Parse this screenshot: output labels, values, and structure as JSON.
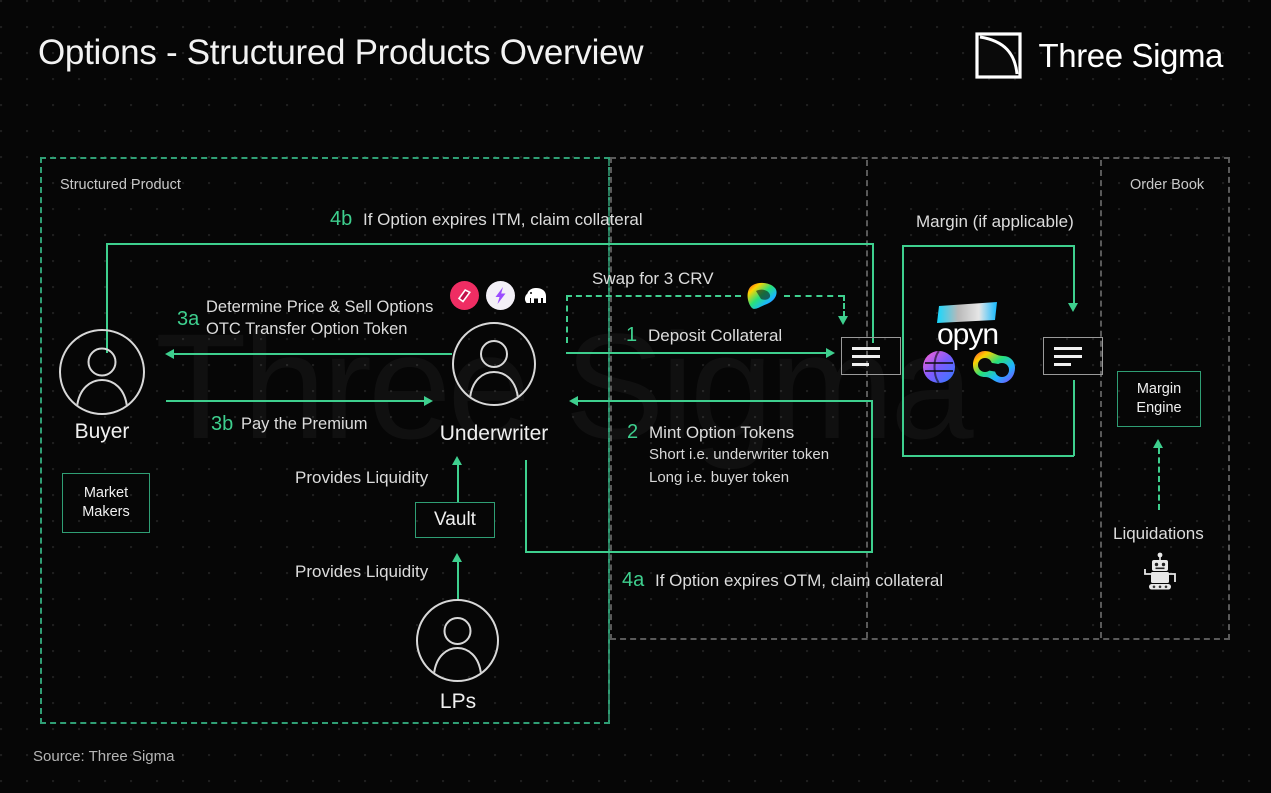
{
  "header": {
    "title": "Options - Structured Products Overview",
    "brand": "Three Sigma",
    "logo_icon": "three-sigma-square-curve-icon"
  },
  "watermark": {
    "text": "Three Sigma"
  },
  "footer": {
    "source": "Source: Three Sigma"
  },
  "regions": [
    {
      "id": "structured-product",
      "label": "Structured Product",
      "border_color": "#2f9e74",
      "style": "dashed"
    },
    {
      "id": "order-book",
      "label": "Order Book",
      "border_color": "#5a5a5a",
      "style": "dashed"
    }
  ],
  "nodes": {
    "buyer": {
      "label": "Buyer",
      "icon": "user-avatar-icon"
    },
    "underwriter": {
      "label": "Underwriter",
      "icon": "user-avatar-icon"
    },
    "lps": {
      "label": "LPs",
      "icon": "user-avatar-icon"
    },
    "market_makers": {
      "label": "Market\nMakers",
      "line1": "Market",
      "line2": "Makers"
    },
    "vault": {
      "label": "Vault"
    },
    "margin_engine": {
      "line1": "Margin",
      "line2": "Engine"
    },
    "liquidations": {
      "label": "Liquidations",
      "icon": "robot-icon"
    },
    "opyn": {
      "label": "opyn",
      "icon": "opyn-logo-icon"
    }
  },
  "labels": {
    "margin_if_applicable": "Margin (if applicable)",
    "swap_for_3crv": "Swap for  3 CRV",
    "provides_liquidity_upper": "Provides Liquidity",
    "provides_liquidity_lower": "Provides Liquidity"
  },
  "steps": [
    {
      "num": "1",
      "text": "Deposit Collateral"
    },
    {
      "num": "2",
      "text": "Mint Option Tokens",
      "sub1": "Short i.e. underwriter token",
      "sub2": "Long i.e. buyer token"
    },
    {
      "num": "3a",
      "text": "Determine Price & Sell Options",
      "sub1": "OTC Transfer Option Token"
    },
    {
      "num": "3b",
      "text": "Pay the Premium"
    },
    {
      "num": "4a",
      "text": "If Option expires OTM, claim collateral"
    },
    {
      "num": "4b",
      "text": "If Option expires ITM, claim collateral"
    }
  ],
  "protocol_icons": [
    {
      "name": "ribbon-finance-icon",
      "color": "#ef2d63"
    },
    {
      "name": "thetanuts-lightning-icon",
      "color": "#ffffff"
    },
    {
      "name": "mammoth-icon",
      "color": "#ffffff"
    },
    {
      "name": "curve-finance-icon",
      "color": "rainbow"
    },
    {
      "name": "aevo-sphere-icon",
      "color": "#5b6ef5"
    },
    {
      "name": "rainbow-ring-icon",
      "color": "rainbow"
    }
  ],
  "order_book_icons": [
    {
      "name": "order-book-icon-left"
    },
    {
      "name": "order-book-icon-right"
    }
  ],
  "colors": {
    "accent_green": "#3ecf8e",
    "region_green": "#2f9e74",
    "region_gray": "#5a5a5a",
    "background": "#060606",
    "text": "#f0f0f0"
  }
}
